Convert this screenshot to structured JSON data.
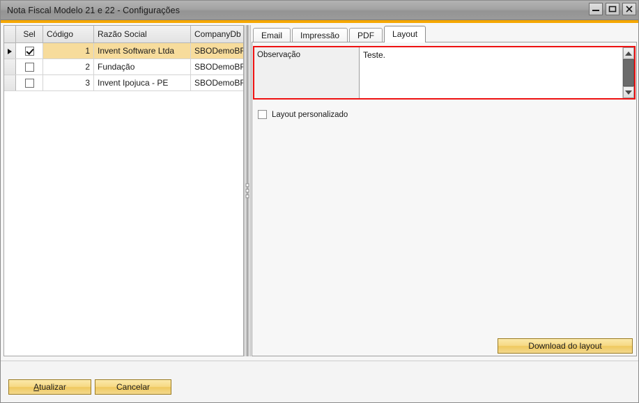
{
  "window": {
    "title": "Nota Fiscal Modelo 21 e 22 - Configurações",
    "accent_color": "#f5a700",
    "controls": {
      "minimize": "minimize-icon",
      "maximize": "maximize-icon",
      "close": "close-icon"
    }
  },
  "grid": {
    "columns": [
      "",
      "Sel",
      "Código",
      "Razão Social",
      "CompanyDb"
    ],
    "rows": [
      {
        "indicator": "▶",
        "selected": true,
        "checked": true,
        "codigo": "1",
        "razao_social": "Invent Software Ltda",
        "company_db": "SBODemoBR"
      },
      {
        "indicator": "",
        "selected": false,
        "checked": false,
        "codigo": "2",
        "razao_social": "Fundação",
        "company_db": "SBODemoBR"
      },
      {
        "indicator": "",
        "selected": false,
        "checked": false,
        "codigo": "3",
        "razao_social": "Invent Ipojuca - PE",
        "company_db": "SBODemoBR"
      }
    ],
    "selected_row_color": "#f7dc9c"
  },
  "tabs": [
    {
      "label": "Email",
      "active": false
    },
    {
      "label": "Impressão",
      "active": false
    },
    {
      "label": "PDF",
      "active": false
    },
    {
      "label": "Layout",
      "active": true
    }
  ],
  "layout_tab": {
    "observation": {
      "label": "Observação",
      "value": "Teste.",
      "highlight_color": "#ee1111",
      "scrollbar": {
        "up": "arrow-up-icon",
        "down": "arrow-down-icon"
      }
    },
    "custom_layout": {
      "label": "Layout personalizado",
      "checked": false
    },
    "download_button": "Download do layout"
  },
  "footer": {
    "update_accel": "A",
    "update_label": "tualizar",
    "cancel_label": "Cancelar"
  }
}
